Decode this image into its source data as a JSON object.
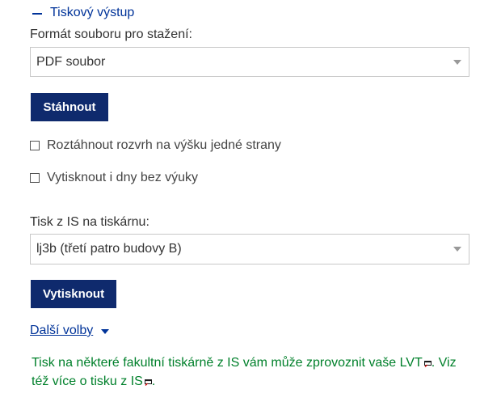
{
  "section": {
    "title": "Tiskový výstup"
  },
  "download": {
    "format_label": "Formát souboru pro stažení:",
    "format_selected": "PDF soubor",
    "button_label": "Stáhnout"
  },
  "options": {
    "stretch_label": "Roztáhnout rozvrh na výšku jedné strany",
    "stretch_checked": false,
    "print_empty_days_label": "Vytisknout i dny bez výuky",
    "print_empty_days_checked": false
  },
  "printer": {
    "label": "Tisk z IS na tiskárnu:",
    "selected": "lj3b (třetí patro budovy B)",
    "button_label": "Vytisknout"
  },
  "more_options": {
    "label": "Další volby"
  },
  "note": {
    "part1": "Tisk na některé fakultní tiskárně z IS vám může zprovoznit vaše ",
    "link1": "LVT",
    "part2": ". Viz též ",
    "link2": "více o tisku z IS",
    "part3": "."
  },
  "colors": {
    "link_blue": "#003399",
    "button_navy": "#0f2a6d",
    "note_green": "#00802b"
  }
}
